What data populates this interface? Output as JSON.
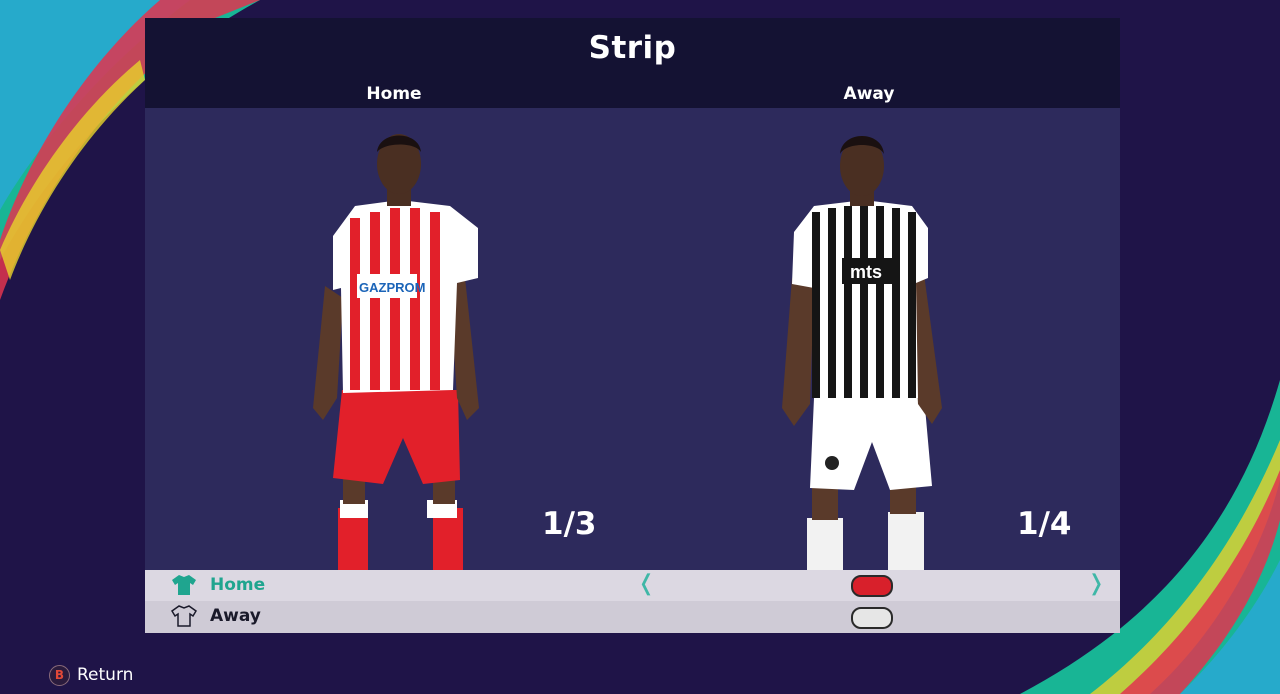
{
  "screen": {
    "title": "Strip"
  },
  "columns": [
    {
      "label": "Home",
      "counter": "1/3"
    },
    {
      "label": "Away",
      "counter": "1/4"
    }
  ],
  "kits": {
    "home": {
      "sponsor": "GAZPROM",
      "colors": [
        "#e2202a",
        "#ffffff"
      ]
    },
    "away": {
      "sponsor": "mts",
      "colors": [
        "#111111",
        "#ffffff"
      ]
    }
  },
  "selector_rows": [
    {
      "label": "Home",
      "icon": "shirt-icon",
      "selected": true,
      "toggle_color": "#d8202b",
      "prev": "❬",
      "next": "❭"
    },
    {
      "label": "Away",
      "icon": "shirt-outline-icon",
      "selected": false,
      "toggle_color": "#e6e6e6"
    }
  ],
  "footer": {
    "button": "B",
    "label": "Return"
  },
  "theme": {
    "accent": "#1fa58f",
    "panel": "#2d2a5c",
    "header": "#141233"
  }
}
